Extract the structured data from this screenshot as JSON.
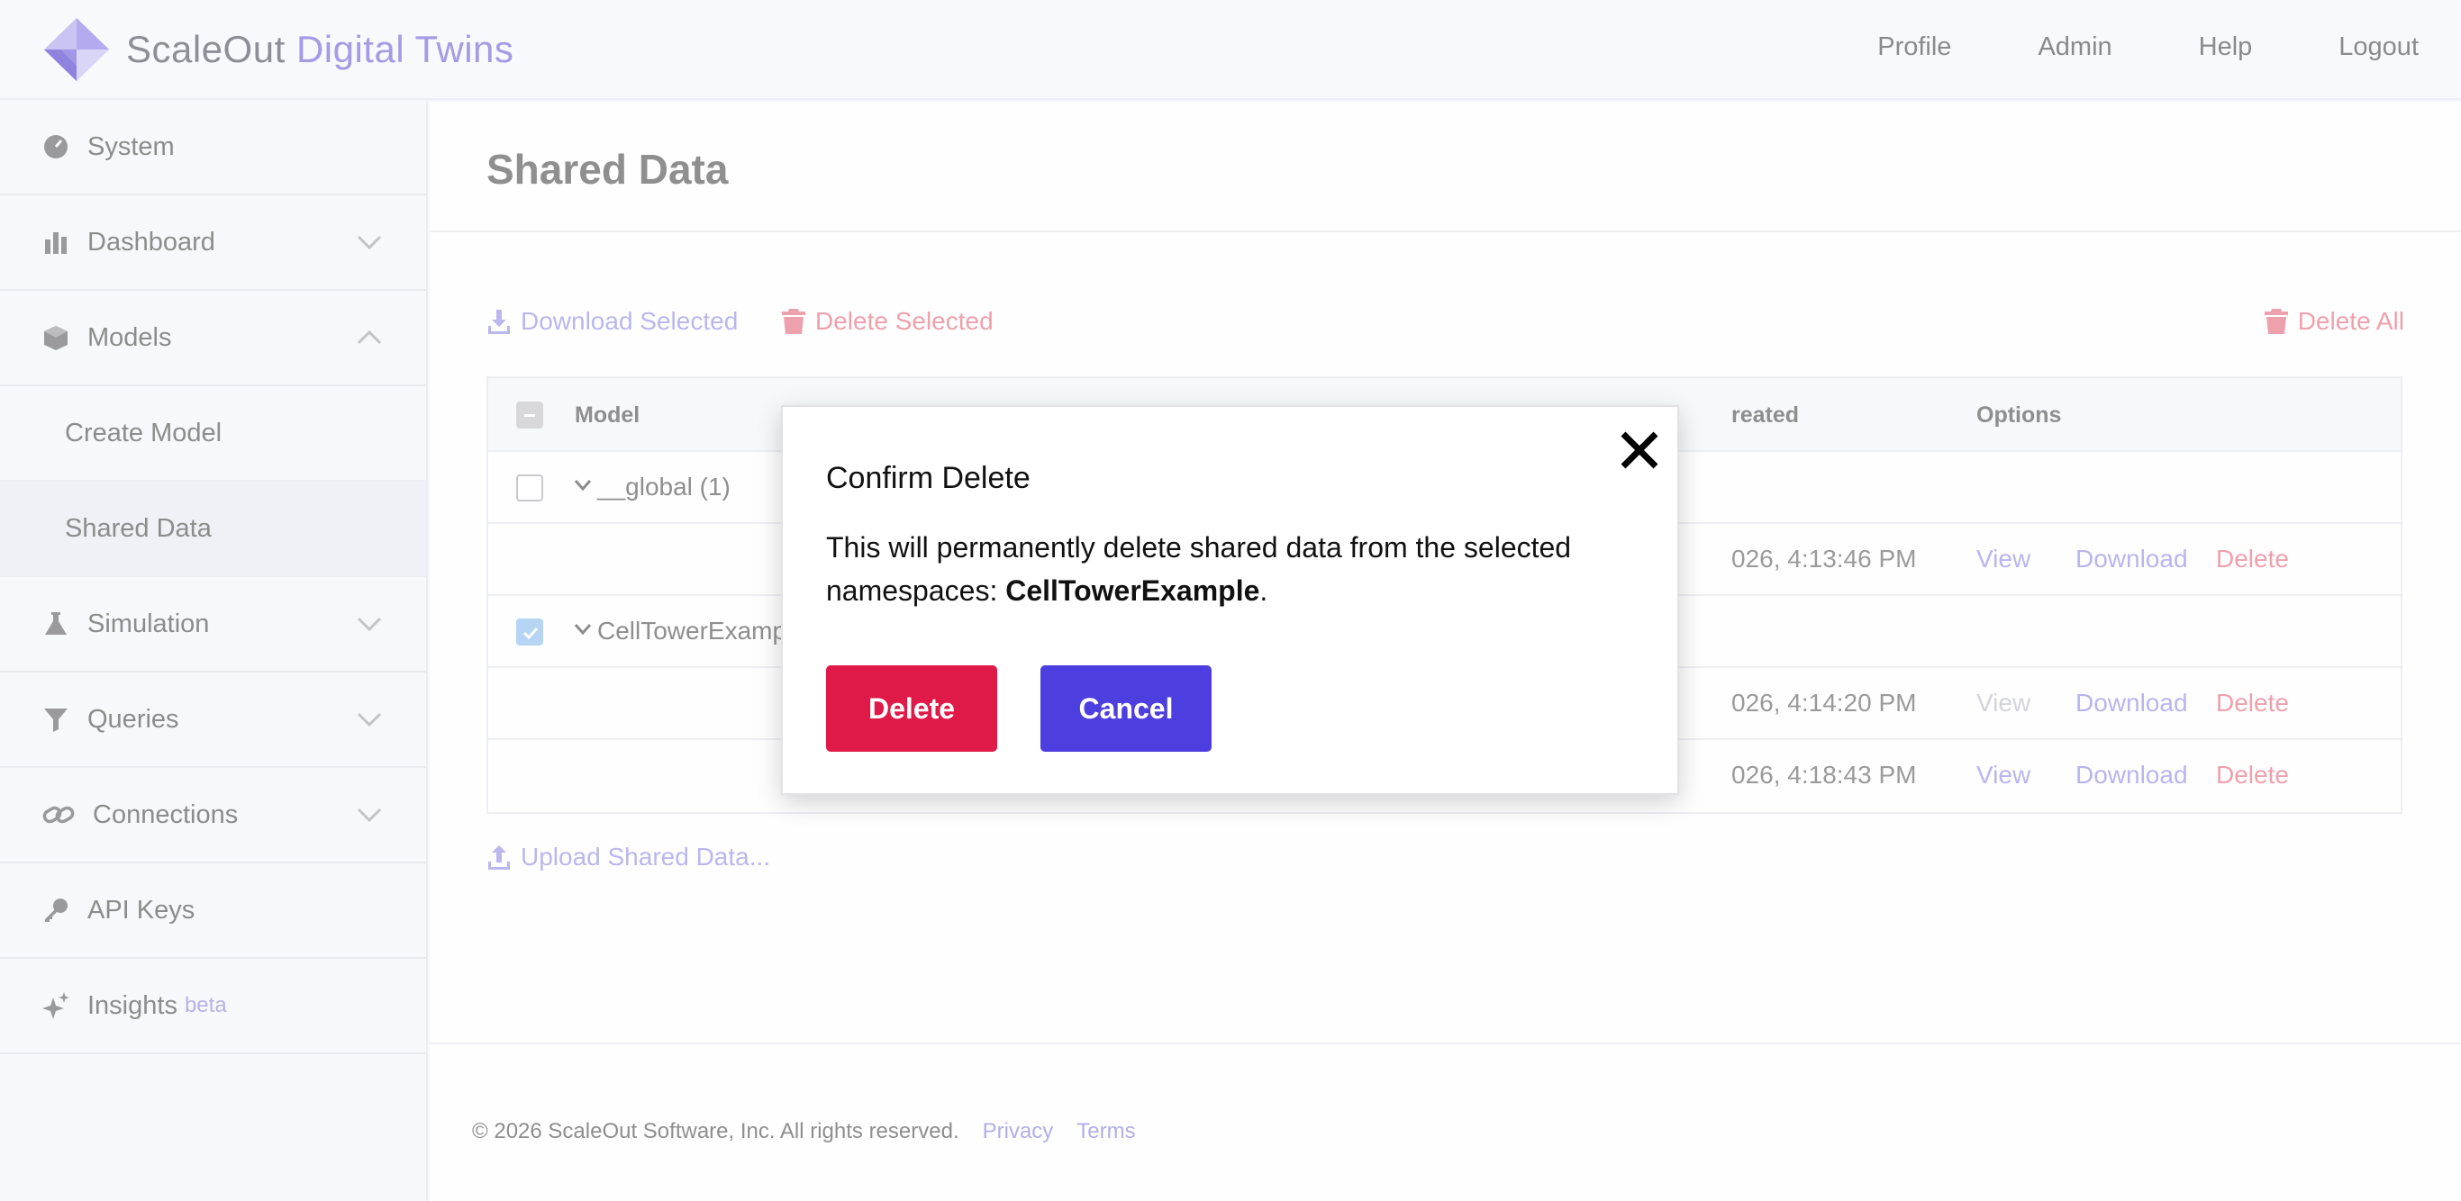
{
  "brand": {
    "name": "ScaleOut",
    "accent": "Digital Twins"
  },
  "topnav": [
    "Profile",
    "Admin",
    "Help",
    "Logout"
  ],
  "sidebar": {
    "items": [
      {
        "label": "System",
        "icon": "gauge-icon"
      },
      {
        "label": "Dashboard",
        "icon": "bar-chart-icon",
        "expand": "chevron-down-icon"
      },
      {
        "label": "Models",
        "icon": "cube-icon",
        "expand": "chevron-up-icon"
      },
      {
        "label": "Simulation",
        "icon": "flask-icon",
        "expand": "chevron-down-icon"
      },
      {
        "label": "Queries",
        "icon": "filter-icon",
        "expand": "chevron-down-icon"
      },
      {
        "label": "Connections",
        "icon": "link-icon",
        "expand": "chevron-down-icon"
      },
      {
        "label": "API Keys",
        "icon": "key-icon"
      },
      {
        "label": "Insights",
        "icon": "sparkle-icon",
        "badge": "beta"
      }
    ],
    "models_sub": [
      "Create Model",
      "Shared Data"
    ],
    "active_sub": "Shared Data"
  },
  "page": {
    "title": "Shared Data"
  },
  "toolbar": {
    "download_selected": "Download Selected",
    "delete_selected": "Delete Selected",
    "delete_all": "Delete All"
  },
  "table": {
    "headers": {
      "model": "Model",
      "created": "reated",
      "options": "Options"
    },
    "rows": [
      {
        "type": "group",
        "label": "__global (1)",
        "checked": false
      },
      {
        "type": "item",
        "created": "026, 4:13:46 PM",
        "view": "View",
        "download": "Download",
        "delete": "Delete"
      },
      {
        "type": "group",
        "label": "CellTowerExamp",
        "checked": true
      },
      {
        "type": "item",
        "created": "026, 4:14:20 PM",
        "view": "View",
        "download": "Download",
        "delete": "Delete"
      },
      {
        "type": "item",
        "created": "026, 4:18:43 PM",
        "view": "View",
        "download": "Download",
        "delete": "Delete"
      }
    ]
  },
  "upload": "Upload Shared Data...",
  "footer": {
    "copyright": "© 2026 ScaleOut Software, Inc. All rights reserved.",
    "privacy": "Privacy",
    "terms": "Terms"
  },
  "modal": {
    "title": "Confirm Delete",
    "message_prefix": "This will permanently delete shared data from the selected namespaces: ",
    "namespace": "CellTowerExample",
    "message_suffix": ".",
    "delete_label": "Delete",
    "cancel_label": "Cancel"
  },
  "colors": {
    "accent": "#4d3ee0",
    "danger": "#e01a48",
    "brand_accent": "#a59ae4"
  }
}
